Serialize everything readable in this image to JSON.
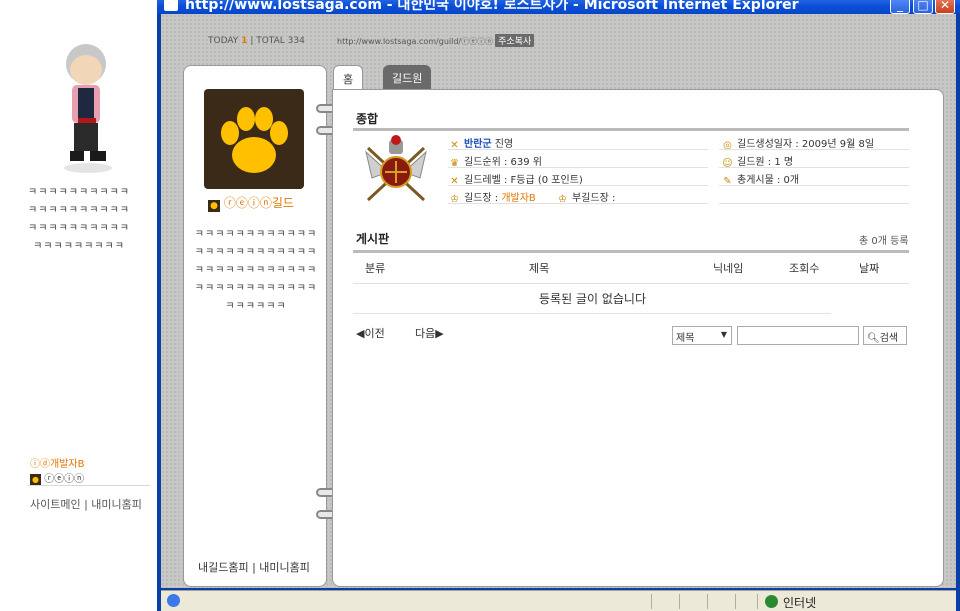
{
  "left_profile": {
    "kk_lines": [
      "ㅋㅋㅋㅋㅋㅋㅋㅋㅋㅋ",
      "ㅋㅋㅋㅋㅋㅋㅋㅋㅋㅋ",
      "ㅋㅋㅋㅋㅋㅋㅋㅋㅋㅋ",
      "ㅋㅋㅋㅋㅋㅋㅋㅋㅋ"
    ],
    "owner_name": "개발자B",
    "guild_name": "ⓡⓔⓘⓝ",
    "links": "사이트메인 | 내미니홈피"
  },
  "window": {
    "title": "http://www.lostsaga.com - 대한민국 이야호! 로스트사가 - Microsoft Internet Explorer",
    "status_zone": "인터넷"
  },
  "counter": {
    "today_label": "TODAY",
    "today": "1",
    "total_label": "TOTAL",
    "total": "334"
  },
  "url": {
    "text": "http://www.lostsaga.com/guild/ⓡⓔⓘⓝ",
    "copy_label": "주소복사"
  },
  "card": {
    "guild_name": "ⓡⓔⓘⓝ길드",
    "lines": [
      "ㅋㅋㅋㅋㅋㅋㅋㅋㅋㅋㅋㅋ",
      "ㅋㅋㅋㅋㅋㅋㅋㅋㅋㅋㅋㅋ",
      "ㅋㅋㅋㅋㅋㅋㅋㅋㅋㅋㅋㅋ",
      "ㅋㅋㅋㅋㅋㅋㅋㅋㅋㅋㅋㅋ",
      "ㅋㅋㅋㅋㅋㅋ"
    ],
    "footer": "내길드홈피 | 내미니홈피"
  },
  "tabs": [
    "홈",
    "길드원"
  ],
  "summary": {
    "title": "종합",
    "faction_name": "반란군",
    "faction_suffix": "진영",
    "rank": "길드순위 : 639 위",
    "level": "길드레벨 : F등급 (0 포인트)",
    "master_label": "길드장 : ",
    "master_name": "개발자B",
    "vice_label": "부길드장 :",
    "created": "길드생성일자 : 2009년 9월 8일",
    "members": "길드원 : 1 명",
    "posts": "총게시물 : 0개"
  },
  "board": {
    "title": "게시판",
    "total": "총 0개 등록",
    "headers": [
      "분류",
      "제목",
      "닉네임",
      "조회수",
      "날짜"
    ],
    "empty": "등록된 글이 없습니다",
    "prev": "◀이전",
    "next": "다음▶",
    "search_field": "제목",
    "search_button": "검색"
  }
}
